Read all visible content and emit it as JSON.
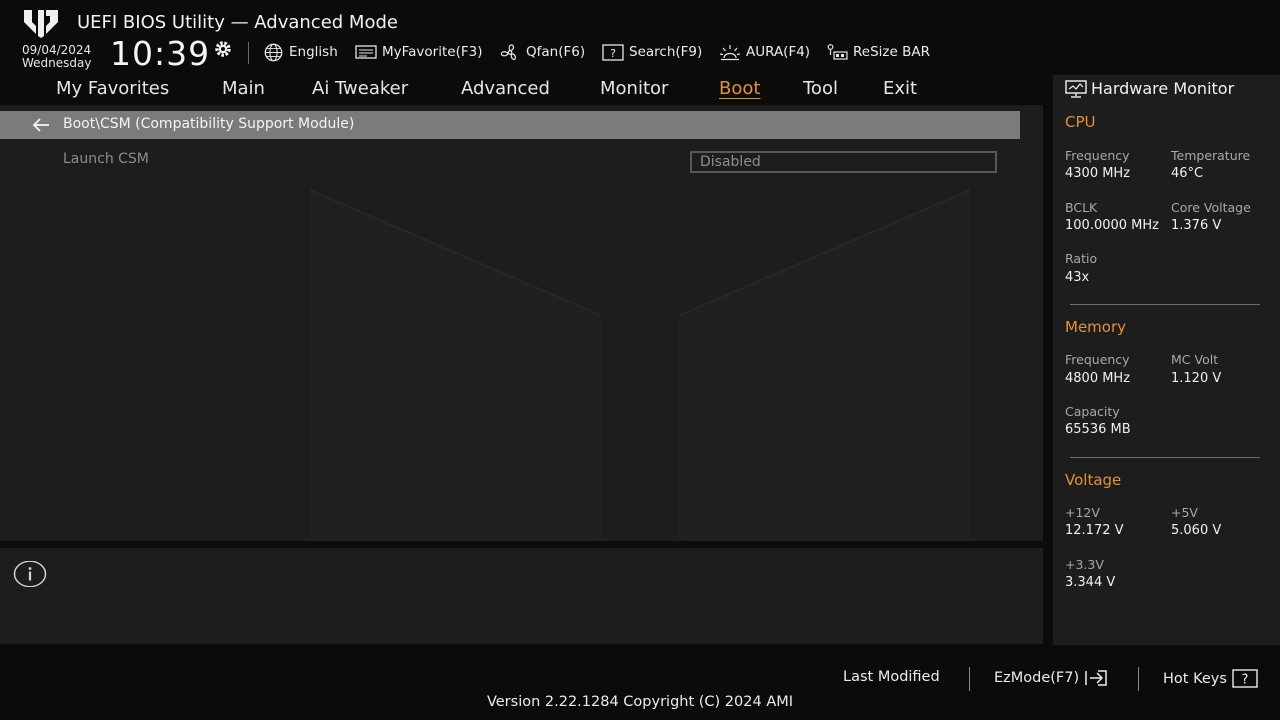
{
  "header": {
    "title": "UEFI BIOS Utility — Advanced Mode",
    "date": "09/04/2024",
    "day": "Wednesday",
    "time": "10:39",
    "tools": [
      {
        "label": "English",
        "icon": "globe-icon"
      },
      {
        "label": "MyFavorite(F3)",
        "icon": "favorite-icon"
      },
      {
        "label": "Qfan(F6)",
        "icon": "fan-icon"
      },
      {
        "label": "Search(F9)",
        "icon": "search-help-icon"
      },
      {
        "label": "AURA(F4)",
        "icon": "aura-icon"
      },
      {
        "label": "ReSize BAR",
        "icon": "resize-bar-icon"
      }
    ]
  },
  "nav": {
    "tabs": [
      "My Favorites",
      "Main",
      "Ai Tweaker",
      "Advanced",
      "Monitor",
      "Boot",
      "Tool",
      "Exit"
    ],
    "active": "Boot"
  },
  "main": {
    "breadcrumb": "Boot\\CSM (Compatibility Support Module)",
    "settings": [
      {
        "label": "Launch CSM",
        "value": "Disabled"
      }
    ]
  },
  "hardware_monitor": {
    "title": "Hardware Monitor",
    "cpu": {
      "title": "CPU",
      "frequency_label": "Frequency",
      "frequency": "4300 MHz",
      "temperature_label": "Temperature",
      "temperature": "46°C",
      "bclk_label": "BCLK",
      "bclk": "100.0000 MHz",
      "core_voltage_label": "Core Voltage",
      "core_voltage": "1.376 V",
      "ratio_label": "Ratio",
      "ratio": "43x"
    },
    "memory": {
      "title": "Memory",
      "frequency_label": "Frequency",
      "frequency": "4800 MHz",
      "mc_volt_label": "MC Volt",
      "mc_volt": "1.120 V",
      "capacity_label": "Capacity",
      "capacity": "65536 MB"
    },
    "voltage": {
      "title": "Voltage",
      "v12_label": "+12V",
      "v12": "12.172 V",
      "v5_label": "+5V",
      "v5": "5.060 V",
      "v33_label": "+3.3V",
      "v33": "3.344 V"
    }
  },
  "footer": {
    "last_modified": "Last Modified",
    "ezmode": "EzMode(F7)",
    "hotkeys": "Hot Keys",
    "version": "Version 2.22.1284 Copyright (C) 2024 AMI"
  },
  "colors": {
    "accent": "#e3922f",
    "panel": "#1d1d1d",
    "breadcrumb_bar": "#7b7b7b"
  }
}
